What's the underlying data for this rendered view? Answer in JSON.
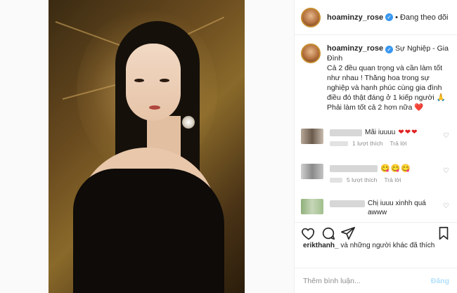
{
  "post": {
    "author": {
      "username": "hoaminzy_rose",
      "verified_icon": "verified-badge-icon",
      "follow_state": "Đang theo dõi"
    },
    "caption": {
      "title": "Sự Nghiệp - Gia Đình",
      "lines": [
        "Cả 2 đều quan trọng và cần làm tốt như nhau ! Thăng hoa trong sự nghiệp và hạnh phúc cùng gia đình điều đó thật đáng ở 1 kiếp người 🙏",
        "Phải làm tốt cả 2 hơn nữa ❤️"
      ]
    },
    "comments": [
      {
        "text": "Mãi iuuuu",
        "emoji": "❤❤❤",
        "likes": "1 lượt thích",
        "reply": "Trả lời"
      },
      {
        "text": "",
        "emoji": "😋😋😋",
        "likes": "5 lượt thích",
        "reply": "Trả lời"
      },
      {
        "text": "Chị iuuu xinhh quá awww",
        "emoji": "",
        "likes": "",
        "reply": ""
      }
    ],
    "likes_summary": {
      "user": "erikthanh_",
      "rest": " và những người khác đã thích"
    },
    "add_comment": {
      "placeholder": "Thêm bình luận...",
      "post_label": "Đăng"
    }
  },
  "colors": {
    "accent": "#3897f0",
    "heart": "#e02020",
    "muted": "#8e8e8e",
    "post_disabled": "#b2dffc"
  }
}
